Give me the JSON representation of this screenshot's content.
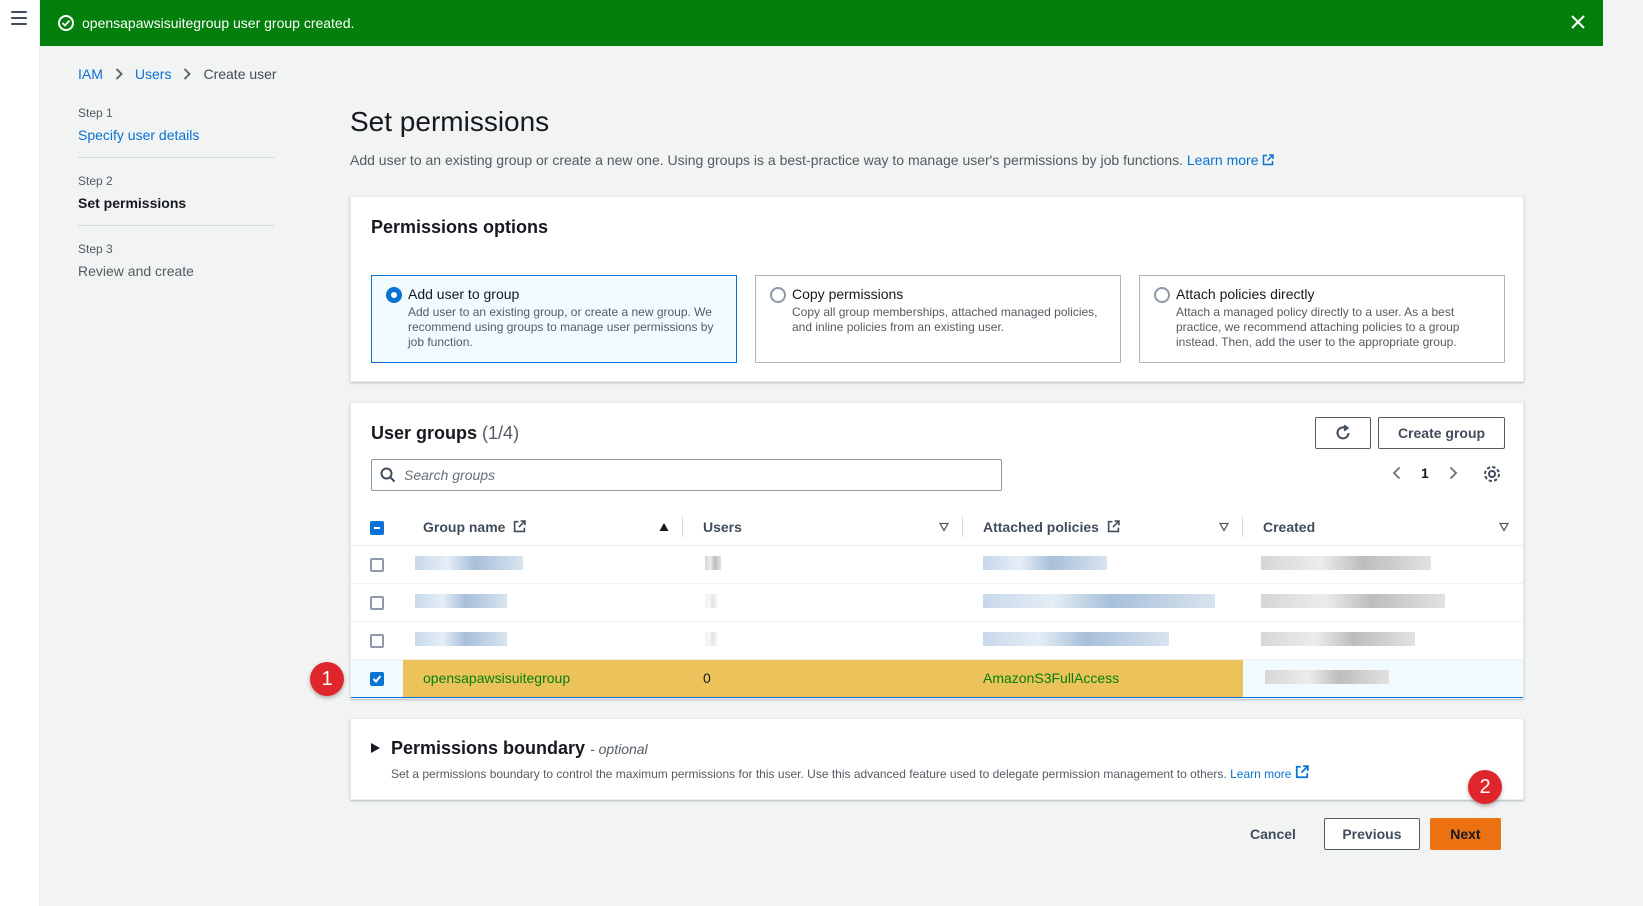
{
  "flash": {
    "message": "opensapawsisuitegroup user group created."
  },
  "breadcrumb": {
    "items": [
      "IAM",
      "Users"
    ],
    "current": "Create user"
  },
  "steps": [
    {
      "num": "Step 1",
      "title": "Specify user details"
    },
    {
      "num": "Step 2",
      "title": "Set permissions"
    },
    {
      "num": "Step 3",
      "title": "Review and create"
    }
  ],
  "page": {
    "title": "Set permissions",
    "description": "Add user to an existing group or create a new one. Using groups is a best-practice way to manage user's permissions by job functions.",
    "learn_more": "Learn more"
  },
  "permissions_options": {
    "title": "Permissions options",
    "options": [
      {
        "title": "Add user to group",
        "desc": "Add user to an existing group, or create a new group. We recommend using groups to manage user permissions by job function."
      },
      {
        "title": "Copy permissions",
        "desc": "Copy all group memberships, attached managed policies, and inline policies from an existing user."
      },
      {
        "title": "Attach policies directly",
        "desc": "Attach a managed policy directly to a user. As a best practice, we recommend attaching policies to a group instead. Then, add the user to the appropriate group."
      }
    ]
  },
  "user_groups": {
    "title": "User groups",
    "count": "(1/4)",
    "create_label": "Create group",
    "search_placeholder": "Search groups",
    "page": "1",
    "columns": [
      "Group name",
      "Users",
      "Attached policies",
      "Created"
    ],
    "selected_row": {
      "name": "opensapawsisuitegroup",
      "users": "0",
      "policies": "AmazonS3FullAccess"
    }
  },
  "boundary": {
    "title": "Permissions boundary",
    "optional": "- optional",
    "desc": "Set a permissions boundary to control the maximum permissions for this user. Use this advanced feature used to delegate permission management to others.",
    "learn_more": "Learn more"
  },
  "actions": {
    "cancel": "Cancel",
    "previous": "Previous",
    "next": "Next"
  },
  "badges": [
    "1",
    "2"
  ],
  "colors": {
    "flash": "#037f0c",
    "link": "#0972d3",
    "primary": "#ec7211",
    "highlight": "#ecc35a",
    "badge": "#e0262d"
  }
}
